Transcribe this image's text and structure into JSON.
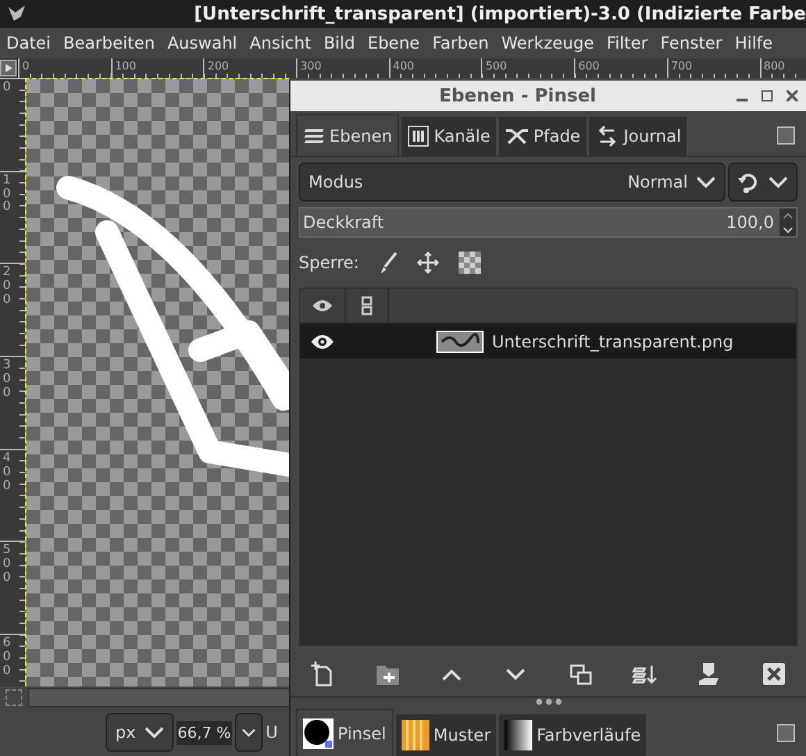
{
  "window": {
    "title": "[Unterschrift_transparent] (importiert)-3.0 (Indizierte Farbe"
  },
  "menu": [
    "Datei",
    "Bearbeiten",
    "Auswahl",
    "Ansicht",
    "Bild",
    "Ebene",
    "Farben",
    "Werkzeuge",
    "Filter",
    "Fenster",
    "Hilfe"
  ],
  "rulers": {
    "horizontal": [
      "0",
      "100",
      "200",
      "300",
      "400",
      "500",
      "600",
      "700",
      "800"
    ],
    "vertical": [
      "0",
      "100",
      "200",
      "300",
      "400",
      "500",
      "600"
    ]
  },
  "dock": {
    "title": "Ebenen - Pinsel",
    "tabs": [
      {
        "kind": "layers",
        "label": "Ebenen",
        "selected": true
      },
      {
        "kind": "channels",
        "label": "Kanäle",
        "selected": false
      },
      {
        "kind": "paths",
        "label": "Pfade",
        "selected": false
      },
      {
        "kind": "history",
        "label": "Journal",
        "selected": false
      }
    ],
    "mode": {
      "label": "Modus",
      "value": "Normal"
    },
    "opacity": {
      "label": "Deckkraft",
      "value": "100,0"
    },
    "lock": {
      "label": "Sperre:"
    },
    "layers": [
      {
        "name": "Unterschrift_transparent.png",
        "visible": true,
        "selected": true
      }
    ],
    "bottom_tabs": [
      {
        "kind": "brush",
        "label": "Pinsel",
        "selected": true
      },
      {
        "kind": "pattern",
        "label": "Muster",
        "selected": false
      },
      {
        "kind": "gradient",
        "label": "Farbverläufe",
        "selected": false
      }
    ]
  },
  "status": {
    "unit": "px",
    "zoom": "66,7 %",
    "cut_text": "U"
  }
}
